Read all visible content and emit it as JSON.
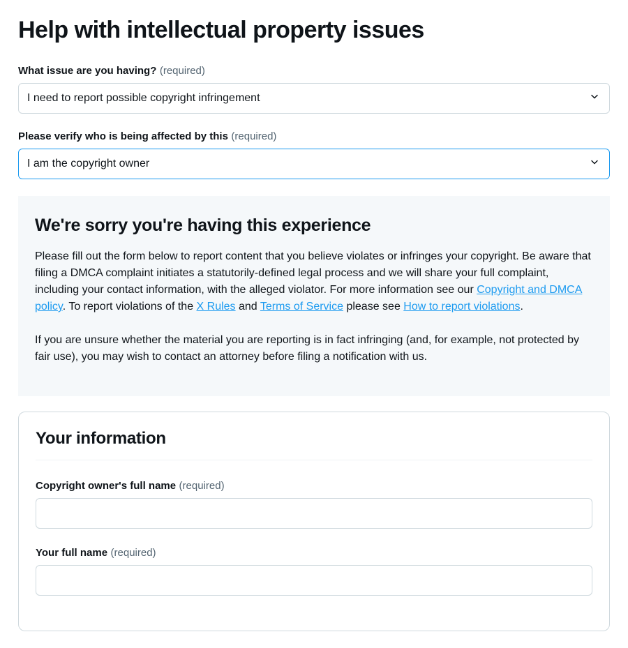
{
  "page": {
    "title": "Help with intellectual property issues"
  },
  "fields": {
    "issue": {
      "label": "What issue are you having?",
      "required_text": "(required)",
      "value": "I need to report possible copyright infringement"
    },
    "affected": {
      "label": "Please verify who is being affected by this",
      "required_text": "(required)",
      "value": "I am the copyright owner"
    }
  },
  "info_panel": {
    "heading": "We're sorry you're having this experience",
    "p1_a": "Please fill out the form below to report content that you believe violates or infringes your copyright. Be aware that filing a DMCA complaint initiates a statutorily-defined legal process and we will share your full complaint, including your contact information, with the alleged violator. For more information see our ",
    "link1": "Copyright and DMCA policy",
    "p1_b": ". To report violations of the ",
    "link2": "X Rules",
    "p1_c": " and ",
    "link3": "Terms of Service",
    "p1_d": " please see ",
    "link4": "How to report violations",
    "p1_e": ".",
    "p2": "If you are unsure whether the material you are reporting is in fact infringing (and, for example, not protected by fair use), you may wish to contact an attorney before filing a notification with us."
  },
  "your_info": {
    "heading": "Your information",
    "owner_name": {
      "label": "Copyright owner's full name",
      "required_text": "(required)"
    },
    "your_name": {
      "label": "Your full name",
      "required_text": "(required)"
    }
  }
}
